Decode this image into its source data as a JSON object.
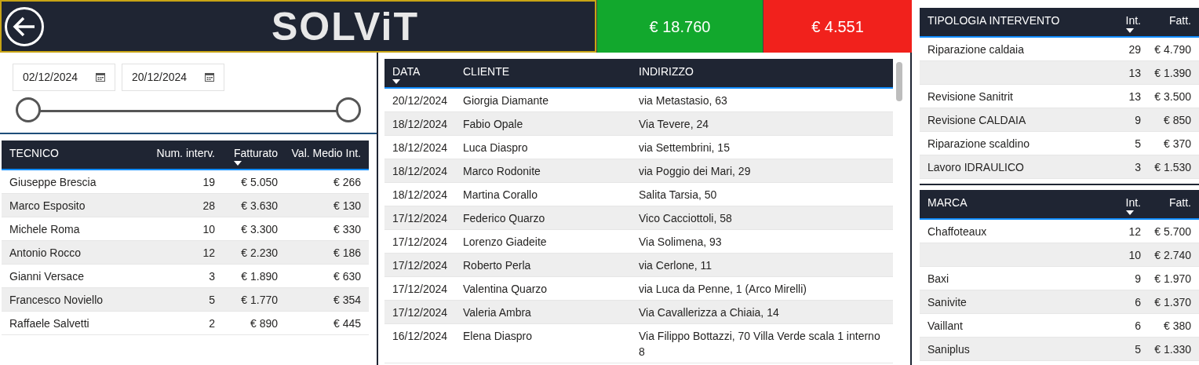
{
  "header": {
    "logo": "SOLViT"
  },
  "kpis": [
    {
      "value": "€ 18.760",
      "color": "#12a82d"
    },
    {
      "value": "€ 4.551",
      "color": "#f1211c"
    }
  ],
  "date_filter": {
    "start": "02/12/2024",
    "end": "20/12/2024",
    "thumbs": [
      {
        "level": 0
      },
      {
        "level": 1
      }
    ]
  },
  "tecnico_table": {
    "columns": [
      {
        "label": "TECNICO",
        "sorted": false
      },
      {
        "label": "Num. interv.",
        "sorted": false
      },
      {
        "label": "Fatturato",
        "sorted": true
      },
      {
        "label": "Val. Medio Int.",
        "sorted": false
      }
    ],
    "rows": [
      [
        "Giuseppe Brescia",
        "19",
        "€ 5.050",
        "€ 266"
      ],
      [
        "Marco Esposito",
        "28",
        "€ 3.630",
        "€ 130"
      ],
      [
        "Michele Roma",
        "10",
        "€ 3.300",
        "€ 330"
      ],
      [
        "Antonio Rocco",
        "12",
        "€ 2.230",
        "€ 186"
      ],
      [
        "Gianni Versace",
        "3",
        "€ 1.890",
        "€ 630"
      ],
      [
        "Francesco Noviello",
        "5",
        "€ 1.770",
        "€ 354"
      ],
      [
        "Raffaele Salvetti",
        "2",
        "€ 890",
        "€ 445"
      ]
    ]
  },
  "interventi_table": {
    "columns": [
      {
        "label": "DATA",
        "sorted": true
      },
      {
        "label": "CLIENTE",
        "sorted": false
      },
      {
        "label": "INDIRIZZO",
        "sorted": false
      }
    ],
    "rows": [
      [
        "20/12/2024",
        "Giorgia Diamante",
        "via Metastasio, 63"
      ],
      [
        "18/12/2024",
        "Fabio Opale",
        "Via Tevere, 24"
      ],
      [
        "18/12/2024",
        "Luca Diaspro",
        "via Settembrini, 15"
      ],
      [
        "18/12/2024",
        "Marco Rodonite",
        "via Poggio dei Mari, 29"
      ],
      [
        "18/12/2024",
        "Martina Corallo",
        "Salita Tarsia, 50"
      ],
      [
        "17/12/2024",
        "Federico Quarzo",
        "Vico Cacciottoli, 58"
      ],
      [
        "17/12/2024",
        "Lorenzo Giadeite",
        "Via Solimena, 93"
      ],
      [
        "17/12/2024",
        "Roberto Perla",
        "via Cerlone, 11"
      ],
      [
        "17/12/2024",
        "Valentina Quarzo",
        "via Luca da Penne, 1 (Arco Mirelli)"
      ],
      [
        "17/12/2024",
        "Valeria Ambra",
        "Via Cavallerizza a Chiaia, 14"
      ],
      [
        "16/12/2024",
        "Elena Diaspro",
        "Via Filippo Bottazzi, 70 Villa Verde scala 1 interno 8"
      ]
    ]
  },
  "tipologia_table": {
    "columns": [
      {
        "label": "TIPOLOGIA INTERVENTO",
        "sorted": false
      },
      {
        "label": "Int.",
        "sorted": true
      },
      {
        "label": "Fatt.",
        "sorted": false
      }
    ],
    "rows": [
      [
        "Riparazione caldaia",
        "29",
        "€ 4.790"
      ],
      [
        "",
        "13",
        "€ 1.390"
      ],
      [
        "Revisione Sanitrit",
        "13",
        "€ 3.500"
      ],
      [
        "Revisione CALDAIA",
        "9",
        "€ 850"
      ],
      [
        "Riparazione scaldino",
        "5",
        "€ 370"
      ],
      [
        "Lavoro IDRAULICO",
        "3",
        "€ 1.530"
      ]
    ]
  },
  "marca_table": {
    "columns": [
      {
        "label": "MARCA",
        "sorted": false
      },
      {
        "label": "Int.",
        "sorted": true
      },
      {
        "label": "Fatt.",
        "sorted": false
      }
    ],
    "rows": [
      [
        "Chaffoteaux",
        "12",
        "€ 5.700"
      ],
      [
        "",
        "10",
        "€ 2.740"
      ],
      [
        "Baxi",
        "9",
        "€ 1.970"
      ],
      [
        "Sanivite",
        "6",
        "€ 1.370"
      ],
      [
        "Vaillant",
        "6",
        "€ 380"
      ],
      [
        "Saniplus",
        "5",
        "€ 1.330"
      ]
    ]
  }
}
